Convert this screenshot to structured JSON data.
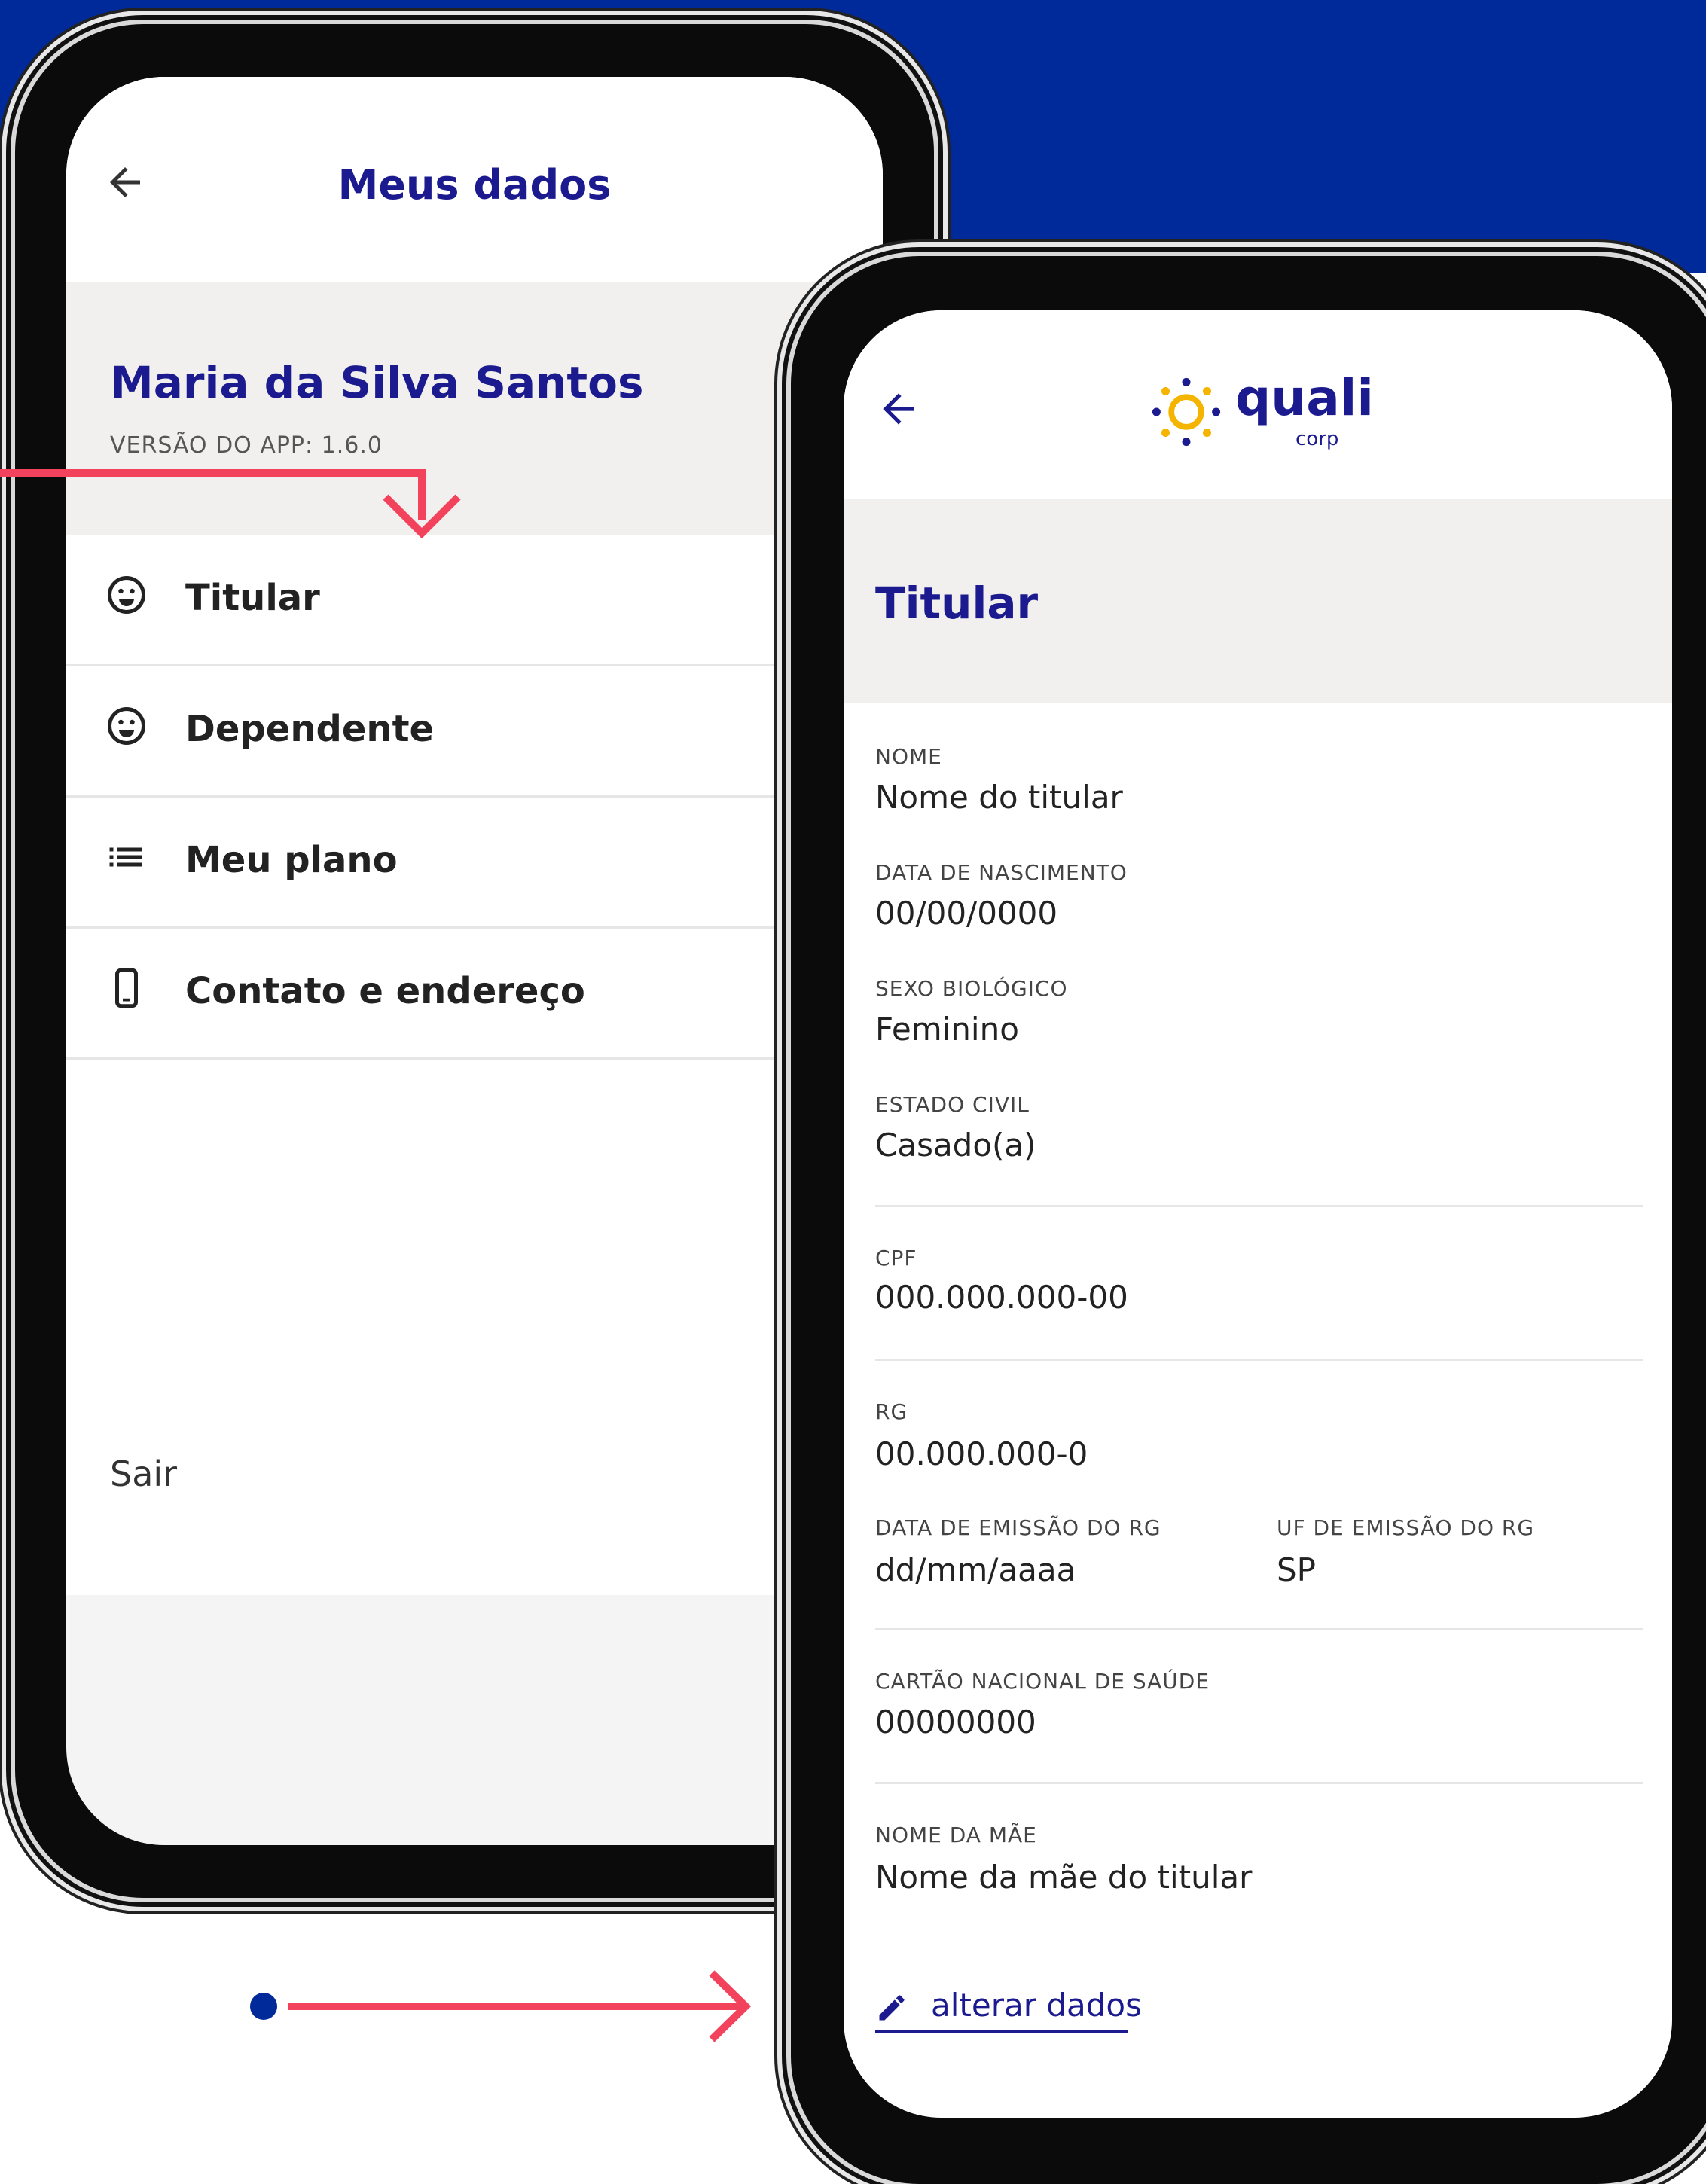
{
  "colors": {
    "brand_blue": "#002a9a",
    "title_blue": "#1b1b8f",
    "accent_red": "#f2425c",
    "logo_yellow": "#f5b400"
  },
  "screen1": {
    "title": "Meus dados",
    "user_name": "Maria da Silva Santos",
    "app_version": "VERSÃO DO APP: 1.6.0",
    "menu": [
      {
        "label": "Titular",
        "icon": "smiley-icon"
      },
      {
        "label": "Dependente",
        "icon": "smiley-icon"
      },
      {
        "label": "Meu plano",
        "icon": "list-icon"
      },
      {
        "label": "Contato e endereço",
        "icon": "phone-icon"
      }
    ],
    "logout": "Sair"
  },
  "screen2": {
    "logo_main": "quali",
    "logo_sub": "corp",
    "section_title": "Titular",
    "fields": {
      "nome": {
        "label": "NOME",
        "value": "Nome do titular"
      },
      "nascimento": {
        "label": "DATA DE NASCIMENTO",
        "value": "00/00/0000"
      },
      "sexo": {
        "label": "SEXO BIOLÓGICO",
        "value": "Feminino"
      },
      "estado_civil": {
        "label": "ESTADO CIVIL",
        "value": "Casado(a)"
      },
      "cpf": {
        "label": "CPF",
        "value": "000.000.000-00"
      },
      "rg": {
        "label": "RG",
        "value": "00.000.000-0"
      },
      "rg_data": {
        "label": "DATA DE EMISSÃO DO RG",
        "value": "dd/mm/aaaa"
      },
      "rg_uf": {
        "label": "UF DE EMISSÃO DO RG",
        "value": "SP"
      },
      "cns": {
        "label": "CARTÃO NACIONAL DE SAÚDE",
        "value": "00000000"
      },
      "mae": {
        "label": "NOME DA MÃE",
        "value": "Nome da mãe do titular"
      }
    },
    "edit_link": "alterar dados"
  }
}
